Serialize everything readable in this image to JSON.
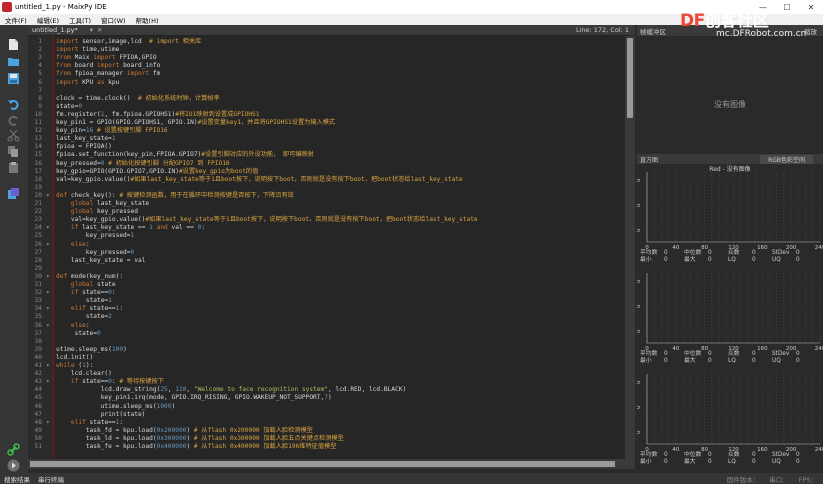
{
  "window": {
    "title": "untitled_1.py - MaixPy IDE",
    "min": "—",
    "max": "☐",
    "close": "✕"
  },
  "watermark": {
    "brand": "DF",
    "name": "创客社区",
    "url": "mc.DFRobot.com.cn"
  },
  "menu": [
    "文件(F)",
    "编辑(E)",
    "工具(T)",
    "窗口(W)",
    "帮助(H)"
  ],
  "editor": {
    "tab": "untitled_1.py*",
    "close": "✕",
    "position": "Line: 172, Col: 1",
    "lines": [
      {
        "n": "1",
        "t": "import sensor,image,lcd  # import 相关库"
      },
      {
        "n": "2",
        "t": "import time,utime"
      },
      {
        "n": "3",
        "t": "from Maix import FPIOA,GPIO"
      },
      {
        "n": "4",
        "t": "from board import board_info"
      },
      {
        "n": "5",
        "t": "from fpioa_manager import fm"
      },
      {
        "n": "6",
        "t": "import KPU as kpu"
      },
      {
        "n": "7",
        "t": ""
      },
      {
        "n": "8",
        "t": "clock = time.clock()  # 初始化系统时钟，计算帧率"
      },
      {
        "n": "9",
        "t": "state=0"
      },
      {
        "n": "10",
        "t": "fm.register(1, fm.fpioa.GPIOHS1)#将IO1映射到设置成GPIOHS1"
      },
      {
        "n": "11",
        "t": "key_pin1 = GPIO(GPIO.GPIOHS1, GPIO.IN)#设置变量key1，并且将GPIOHS1设置为输入模式"
      },
      {
        "n": "12",
        "t": "key_pin=16 # 设置按键引脚 FPIO16"
      },
      {
        "n": "13",
        "t": "last_key_state=1"
      },
      {
        "n": "14",
        "t": "fpioa = FPIOA()"
      },
      {
        "n": "15",
        "t": "fpioa.set_function(key_pin,FPIOA.GPIO7)#设置引脚对应的外设功能， 即可编映射"
      },
      {
        "n": "16",
        "t": "key_pressed=0 # 初始化按键引脚 分配GPIO7 到 FPIO16"
      },
      {
        "n": "17",
        "t": "key_gpio=GPIO(GPIO.GPIO7,GPIO.IN)#设置key_gpio为boot的值"
      },
      {
        "n": "18",
        "t": "val=key_gpio.value()#如果last_key_state等于1且boot按下，说明按下boot，否则就是没有按下boot，把boot状态给last_key_state"
      },
      {
        "n": "19",
        "t": ""
      },
      {
        "n": "20",
        "t": "def check_key(): # 按键检测函数，用于在循环中检测按键是否按下，下降沿有效"
      },
      {
        "n": "21",
        "t": "    global last_key_state"
      },
      {
        "n": "22",
        "t": "    global key_pressed"
      },
      {
        "n": "23",
        "t": "    val=key_gpio.value()#如果last_key_state等于1且boot按下，说明按下boot，否则就是没有按下boot，把boot状态给last_key_state"
      },
      {
        "n": "24",
        "t": "    if last_key_state == 1 and val == 0:"
      },
      {
        "n": "25",
        "t": "        key_pressed=1"
      },
      {
        "n": "26",
        "t": "    else:"
      },
      {
        "n": "27",
        "t": "        key_pressed=0"
      },
      {
        "n": "28",
        "t": "    last_key_state = val"
      },
      {
        "n": "29",
        "t": ""
      },
      {
        "n": "30",
        "t": "def mode(key_num):"
      },
      {
        "n": "31",
        "t": "    global state"
      },
      {
        "n": "32",
        "t": "    if state==0:"
      },
      {
        "n": "33",
        "t": "        state=1"
      },
      {
        "n": "34",
        "t": "    elif state==1:"
      },
      {
        "n": "35",
        "t": "        state=2"
      },
      {
        "n": "36",
        "t": "    else:"
      },
      {
        "n": "37",
        "t": "     state=0"
      },
      {
        "n": "38",
        "t": ""
      },
      {
        "n": "39",
        "t": "utime.sleep_ms(100)"
      },
      {
        "n": "40",
        "t": "lcd.init()"
      },
      {
        "n": "41",
        "t": "while (1):"
      },
      {
        "n": "42",
        "t": "    lcd.clear()"
      },
      {
        "n": "43",
        "t": "    if state==0: # 等待按键按下"
      },
      {
        "n": "44",
        "t": "            lcd.draw_string(25, 110, \"Welcome to face recognition system\", lcd.RED, lcd.BLACK)"
      },
      {
        "n": "45",
        "t": "            key_pin1.irq(mode, GPIO.IRQ_RISING, GPIO.WAKEUP_NOT_SUPPORT,7)"
      },
      {
        "n": "46",
        "t": "            utime.sleep_ms(1000)"
      },
      {
        "n": "47",
        "t": "            print(state)"
      },
      {
        "n": "48",
        "t": "    elif state==1:"
      },
      {
        "n": "49",
        "t": "        task_fd = kpu.load(0x200000) # 从flash 0x200000 加载人脸检测模型"
      },
      {
        "n": "50",
        "t": "        task_ld = kpu.load(0x300000) # 从flash 0x300000 加载人脸五点关键点检测模型"
      },
      {
        "n": "51",
        "t": "        task_fe = kpu.load(0x400000) # 从flash 0x400000 加载人脸196维特征值模型"
      }
    ]
  },
  "framebuffer": {
    "title": "帧缓冲区",
    "option": "缩放",
    "empty": "没有图像"
  },
  "histogram": {
    "title": "直方图",
    "colorspace": "RGB色彩空间",
    "channels": [
      {
        "title": "Red - 没有图像",
        "y_ticks": [
          "0",
          "0",
          "0"
        ]
      },
      {
        "title": "",
        "y_ticks": [
          "0",
          "0",
          "0"
        ]
      },
      {
        "title": "",
        "y_ticks": [
          "0",
          "0",
          "0"
        ]
      }
    ],
    "x_ticks": [
      "0",
      "40",
      "80",
      "120",
      "160",
      "200",
      "240"
    ],
    "stats_labels_1": [
      "平均数",
      "中位数",
      "众数",
      "StDev"
    ],
    "stats_labels_2": [
      "最小",
      "最大",
      "LQ",
      "UQ"
    ],
    "stats_value": "0"
  },
  "statusbar": {
    "items": [
      "搜索结果",
      "串行终端"
    ],
    "right": [
      "固件版本：",
      "串口：",
      "FPS："
    ]
  },
  "colors": {
    "keyword": "#cc7833",
    "string": "#a5c25c",
    "comment": "#d9a441",
    "text": "#d7d7d7",
    "accent": "#c2272d"
  }
}
